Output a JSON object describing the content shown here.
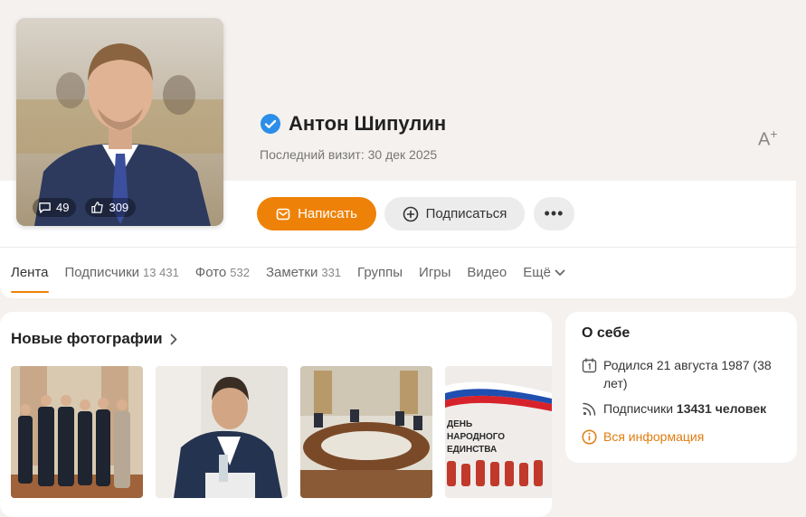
{
  "profile": {
    "name": "Антон Шипулин",
    "last_visit_label": "Последний визит:",
    "last_visit_date": "30 дек 2025",
    "comments_count": "49",
    "likes_count": "309"
  },
  "actions": {
    "write_label": "Написать",
    "subscribe_label": "Подписаться",
    "more_label": "•••",
    "font_size_label": "A"
  },
  "tabs": [
    {
      "label": "Лента",
      "count": ""
    },
    {
      "label": "Подписчики",
      "count": "13 431"
    },
    {
      "label": "Фото",
      "count": "532"
    },
    {
      "label": "Заметки",
      "count": "331"
    },
    {
      "label": "Группы",
      "count": ""
    },
    {
      "label": "Игры",
      "count": ""
    },
    {
      "label": "Видео",
      "count": ""
    },
    {
      "label": "Ещё",
      "count": ""
    }
  ],
  "photos": {
    "title": "Новые фотографии",
    "poster_text": [
      "ДЕНЬ",
      "НАРОДНОГО",
      "ЕДИНСТВА"
    ]
  },
  "about": {
    "title": "О себе",
    "born": "Родился 21 августа 1987 (38 лет)",
    "subscribers_prefix": "Подписчики",
    "subscribers_value": "13431 человек",
    "all_info": "Вся информация"
  },
  "colors": {
    "accent": "#ee8208",
    "verified": "#2b8ee8",
    "background": "#f4f1ee"
  }
}
